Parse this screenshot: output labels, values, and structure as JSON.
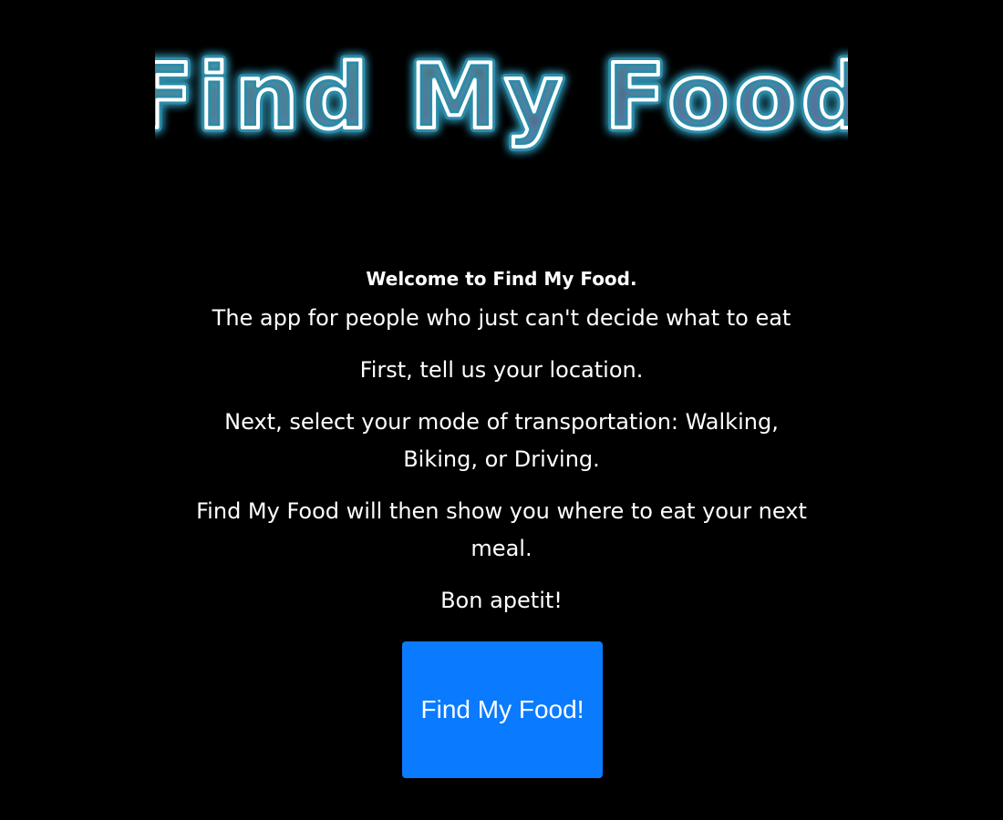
{
  "header": {
    "logo_text": "Find My Food",
    "logo_stroke_color": "#ffffff",
    "logo_glow_color": "#3fc7f0",
    "logo_fill_colors": [
      "#7ee6d9",
      "#b58cf5"
    ]
  },
  "intro": {
    "welcome": "Welcome to Find My Food.",
    "paragraphs": [
      "The app for people who just can't decide what to eat",
      "First, tell us your location.",
      "Next, select your mode of transportation: Walking, Biking, or Driving.",
      "Find My Food will then show you where to eat your next meal.",
      "Bon apetit!"
    ]
  },
  "cta": {
    "label": "Find My Food!",
    "color": "#0a7bff"
  }
}
